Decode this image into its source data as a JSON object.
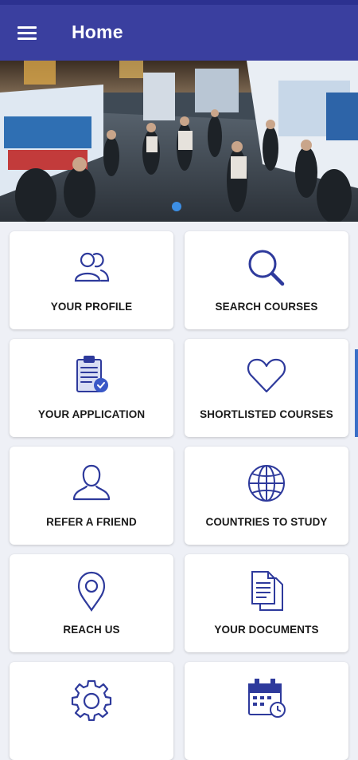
{
  "appbar": {
    "title": "Home",
    "menu_icon": "hamburger-menu-icon",
    "color": "#3a3f9f"
  },
  "banner": {
    "description_icon": "education-fair-photo",
    "slides": 1,
    "active_slide": 1,
    "indicator_color": "#3c8ee4"
  },
  "tiles": [
    {
      "label": "YOUR PROFILE",
      "icon": "users-icon"
    },
    {
      "label": "SEARCH COURSES",
      "icon": "search-icon"
    },
    {
      "label": "YOUR APPLICATION",
      "icon": "clipboard-check-icon"
    },
    {
      "label": "SHORTLISTED COURSES",
      "icon": "heart-icon"
    },
    {
      "label": "REFER A FRIEND",
      "icon": "user-icon"
    },
    {
      "label": "COUNTRIES TO STUDY",
      "icon": "globe-icon"
    },
    {
      "label": "REACH US",
      "icon": "map-pin-icon"
    },
    {
      "label": "YOUR DOCUMENTS",
      "icon": "documents-icon"
    },
    {
      "label": "",
      "icon": "gear-icon"
    },
    {
      "label": "",
      "icon": "calendar-icon"
    }
  ],
  "colors": {
    "icon_stroke": "#2e3a9c",
    "accent": "#3a3f9f"
  }
}
